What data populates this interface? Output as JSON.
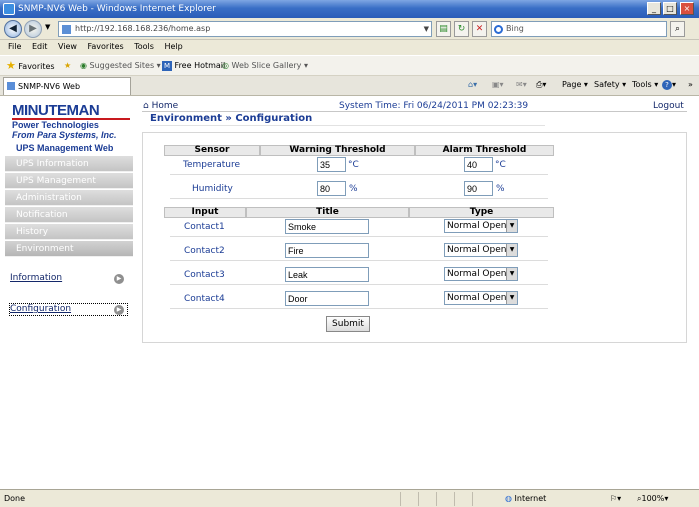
{
  "window": {
    "title": "SNMP-NV6 Web - Windows Internet Explorer",
    "minimize": "_",
    "maximize": "□",
    "close": "×"
  },
  "browser": {
    "address": "http://192.168.168.236/home.asp",
    "search_placeholder": "Bing",
    "menu": [
      "File",
      "Edit",
      "View",
      "Favorites",
      "Tools",
      "Help"
    ],
    "favorites_label": "Favorites",
    "suggested_sites": "Suggested Sites ▾",
    "free_hotmail": "Free Hotmail",
    "web_slice_gallery": "Web Slice Gallery ▾",
    "tab_title": "SNMP-NV6 Web",
    "tools": {
      "page": "Page ▾",
      "safety": "Safety ▾",
      "tools": "Tools ▾",
      "help": "▾"
    }
  },
  "brand": {
    "logo_main": "MINUTEMAN",
    "logo_line2": "Power Technologies",
    "logo_line3": "From Para Systems, Inc.",
    "subtitle": "UPS Management Web",
    "accent": "#1b3c95"
  },
  "header": {
    "home": "Home",
    "system_time": "System Time: Fri 06/24/2011 PM 02:23:39",
    "logout": "Logout"
  },
  "sidebar": {
    "items": [
      {
        "label": "UPS Information"
      },
      {
        "label": "UPS Management"
      },
      {
        "label": "Administration"
      },
      {
        "label": "Notification"
      },
      {
        "label": "History"
      },
      {
        "label": "Environment"
      }
    ],
    "sublinks": [
      {
        "label": "Information"
      },
      {
        "label": "Configuration"
      }
    ]
  },
  "page": {
    "heading": "Environment » Configuration"
  },
  "sensor_table": {
    "headers": [
      "Sensor",
      "Warning Threshold",
      "Alarm Threshold"
    ],
    "rows": [
      {
        "name": "Temperature",
        "warning": "35",
        "alarm": "40",
        "unit": "°C"
      },
      {
        "name": "Humidity",
        "warning": "80",
        "alarm": "90",
        "unit": "%"
      }
    ]
  },
  "contact_table": {
    "headers": [
      "Input",
      "Title",
      "Type"
    ],
    "rows": [
      {
        "input": "Contact1",
        "title": "Smoke",
        "type": "Normal Open"
      },
      {
        "input": "Contact2",
        "title": "Fire",
        "type": "Normal Open"
      },
      {
        "input": "Contact3",
        "title": "Leak",
        "type": "Normal Open"
      },
      {
        "input": "Contact4",
        "title": "Door",
        "type": "Normal Open"
      }
    ]
  },
  "submit_label": "Submit",
  "status": {
    "left": "Done",
    "zone": "Internet",
    "zoom": "100%"
  }
}
